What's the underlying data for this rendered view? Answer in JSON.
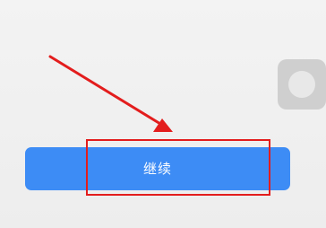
{
  "button": {
    "label": "继续"
  },
  "colors": {
    "background": "#f0f0f0",
    "button_background": "#3d8cf5",
    "button_text": "#ffffff",
    "annotation": "#e31d1d",
    "floating_ball": "#cfcfcf"
  },
  "icons": {
    "floating_ball": "assistive-touch-icon"
  }
}
